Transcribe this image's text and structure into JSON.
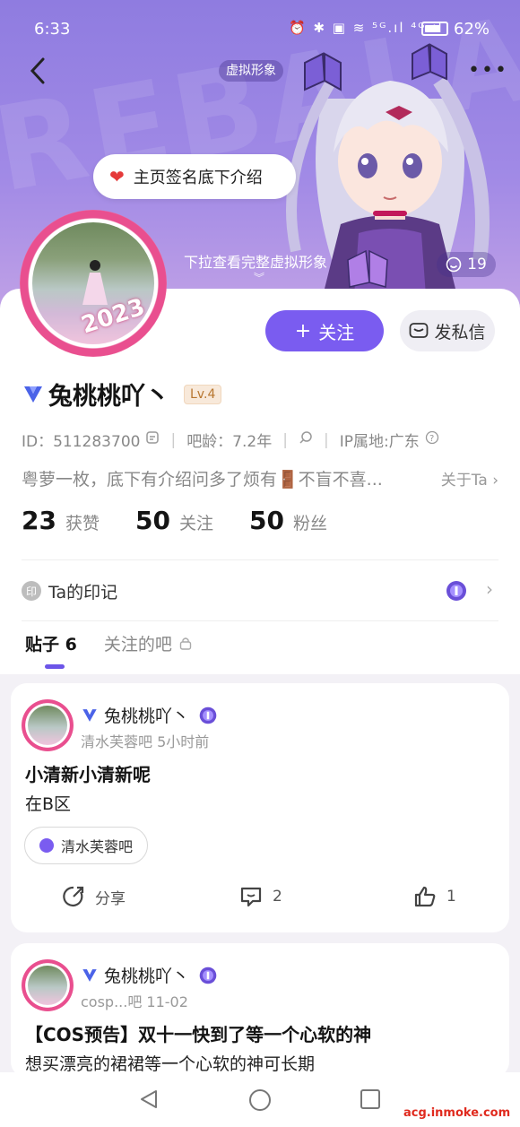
{
  "status_bar": {
    "time": "6:33",
    "icons": "⏰ ✱ ▣ ≋ ⁵ᴳ.ıl ⁴ᴳ.ıl",
    "battery_pct": "62%"
  },
  "header": {
    "avatar_tag": "虚拟形象",
    "bubble_text": "主页签名底下介绍",
    "pull_hint": "下拉查看完整虚拟形象",
    "like_count": "19",
    "banner_watermark": "REBALA"
  },
  "profile": {
    "avatar_year": "2023",
    "name": "兔桃桃吖丶",
    "level": "Lv.4",
    "id_text": "ID：511283700",
    "bar_age": "吧龄：7.2年",
    "ip_location": "IP属地:广东",
    "bio": "粤萝一枚，底下有介绍问多了烦有🚪不盲不喜...",
    "about_link": "关于Ta",
    "follow_button": "关注",
    "message_button": "发私信",
    "stats": [
      {
        "num": "23",
        "label": "获赞"
      },
      {
        "num": "50",
        "label": "关注"
      },
      {
        "num": "50",
        "label": "粉丝"
      }
    ],
    "marks_icon": "印",
    "marks_label": "Ta的印记"
  },
  "tabs": [
    {
      "label": "贴子 6",
      "active": true
    },
    {
      "label": "关注的吧",
      "active": false
    }
  ],
  "posts": [
    {
      "author": "兔桃桃吖丶",
      "meta": "清水芙蓉吧  5小时前",
      "title": "小清新小清新呢",
      "body": "在B区",
      "forum_chip": "清水芙蓉吧",
      "share_label": "分享",
      "comments": "2",
      "likes": "1"
    },
    {
      "author": "兔桃桃吖丶",
      "meta": "cosp...吧  11-02",
      "title": "【COS预告】双十一快到了等一个心软的神",
      "body": "想买漂亮的裙裙等一个心软的神可长期"
    }
  ],
  "footer_watermark": "acg.inmoke.com",
  "colors": {
    "accent": "#7a5cf0",
    "banner": "#9a84e4",
    "heart": "#e53a3a"
  }
}
